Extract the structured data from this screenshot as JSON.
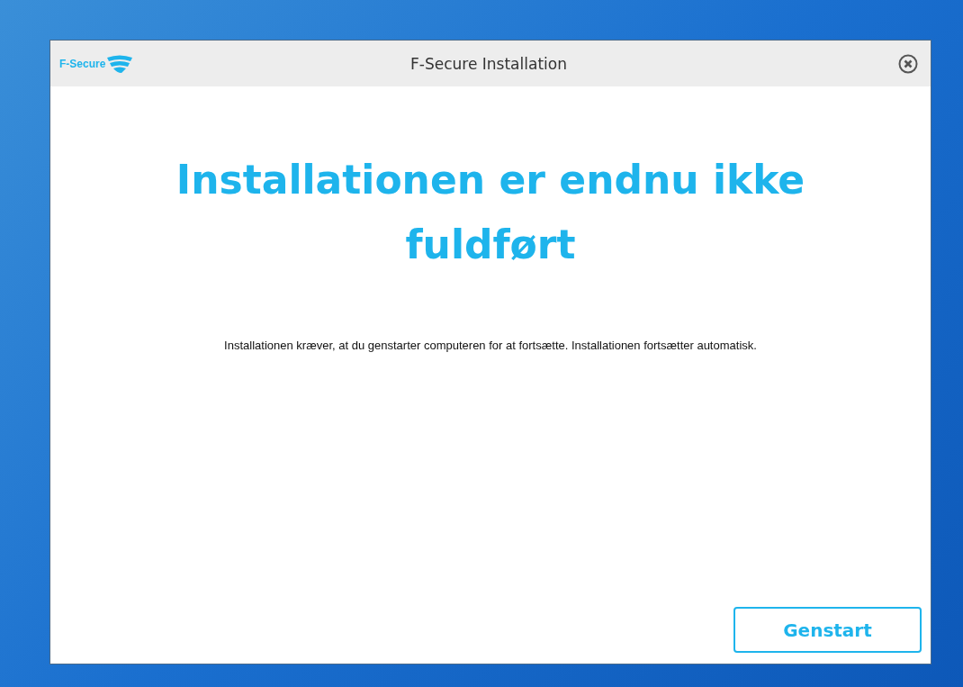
{
  "window": {
    "logo_text": "F-Secure",
    "title": "F-Secure Installation"
  },
  "heading": "Installationen er endnu ikke fuldført",
  "message": "Installationen kræver, at du genstarter computeren for at fortsætte. Installationen fortsætter automatisk.",
  "buttons": [
    "Genstart"
  ]
}
